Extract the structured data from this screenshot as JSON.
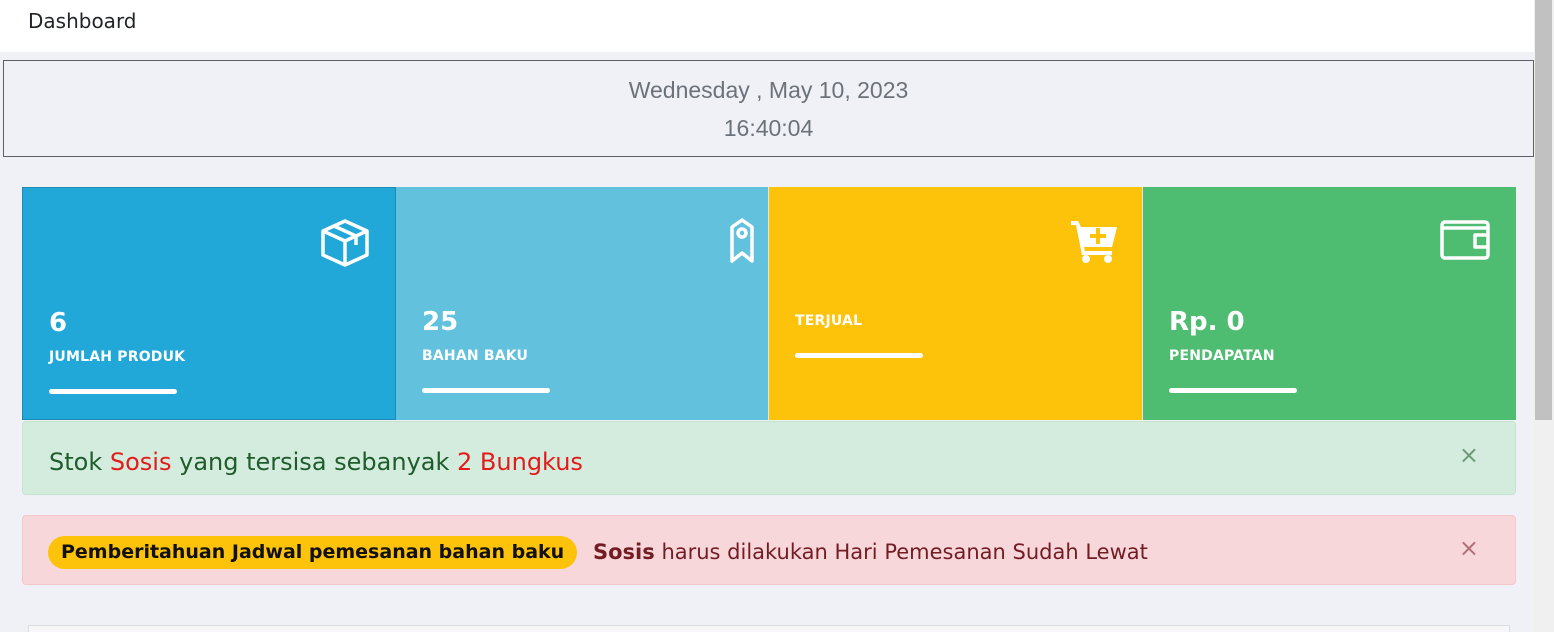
{
  "header": {
    "title": "Dashboard"
  },
  "datetime": {
    "date": "Wednesday , May 10, 2023",
    "time": "16:40:04"
  },
  "cards": [
    {
      "value": "6",
      "label": "JUMLAH PRODUK",
      "icon": "box-icon",
      "color": "#21a7d8"
    },
    {
      "value": "25",
      "label": "BAHAN BAKU",
      "icon": "tag-icon",
      "color": "#62c1dd"
    },
    {
      "value": "",
      "label": "TERJUAL",
      "icon": "cart-plus-icon",
      "color": "#fdc20a"
    },
    {
      "value": "Rp. 0",
      "label": "PENDAPATAN",
      "icon": "wallet-icon",
      "color": "#4fbd71"
    }
  ],
  "stock_alert": {
    "prefix": "Stok",
    "item": "Sosis",
    "middle": "yang tersisa sebanyak",
    "amount": "2 Bungkus",
    "close": "×"
  },
  "order_alert": {
    "badge": "Pemberitahuan Jadwal pemesanan bahan baku",
    "item": "Sosis",
    "message": "harus dilakukan Hari Pemesanan Sudah Lewat",
    "close": "×"
  }
}
